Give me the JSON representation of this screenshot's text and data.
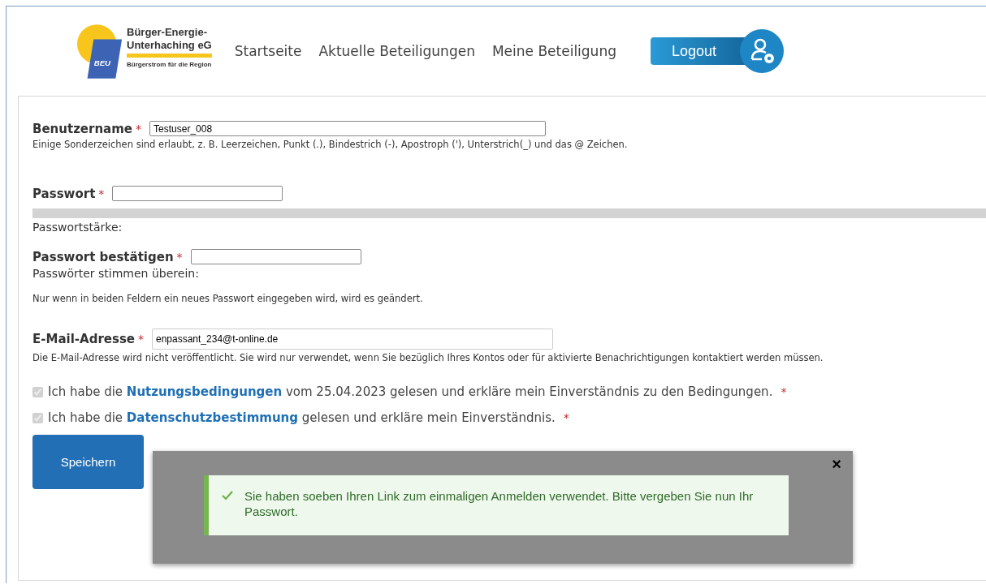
{
  "logo": {
    "badge": "BEU",
    "line1": "Bürger-Energie-",
    "line2": "Unterhaching eG",
    "tagline": "Bürgerstrom für die Region"
  },
  "nav": [
    {
      "label": "Startseite"
    },
    {
      "label": "Aktuelle Beteiligungen"
    },
    {
      "label": "Meine Beteiligung"
    }
  ],
  "logout": {
    "label": "Logout"
  },
  "form": {
    "username": {
      "label": "Benutzername",
      "required": "*",
      "value": "Testuser_008",
      "hint": "Einige Sonderzeichen sind erlaubt, z. B. Leerzeichen, Punkt (.), Bindestrich (-), Apostroph ('), Unterstrich(_) und das @ Zeichen."
    },
    "password": {
      "label": "Passwort",
      "required": "*",
      "strength_label": "Passwortstärke:"
    },
    "confirm": {
      "label": "Passwort bestätigen",
      "required": "*",
      "match_label": "Passwörter stimmen überein:",
      "hint": "Nur wenn in beiden Feldern ein neues Passwort eingegeben wird, wird es geändert."
    },
    "email": {
      "label": "E-Mail-Adresse",
      "required": "*",
      "value": "enpassant_234@t-online.de",
      "hint": "Die E-Mail-Adresse wird nicht veröffentlicht. Sie wird nur verwendet, wenn Sie bezüglich Ihres Kontos oder für aktivierte Benachrichtigungen kontaktiert werden müssen."
    },
    "consents": [
      {
        "before": "Ich habe die ",
        "link": "Nutzungsbedingungen",
        "after": " vom 25.04.2023 gelesen und erkläre mein Einverständnis zu den Bedingungen.",
        "required": "*",
        "checked": true,
        "disabled": true
      },
      {
        "before": "Ich habe die ",
        "link": "Datenschutzbestimmung",
        "after": " gelesen und erkläre mein Einverständnis.",
        "required": "*",
        "checked": true,
        "disabled": true
      }
    ],
    "save": {
      "label": "Speichern"
    }
  },
  "message": {
    "close": "×",
    "text": "Sie haben soeben Ihren Link zum einmaligen Anmelden verwendet. Bitte vergeben Sie nun Ihr Passwort."
  }
}
